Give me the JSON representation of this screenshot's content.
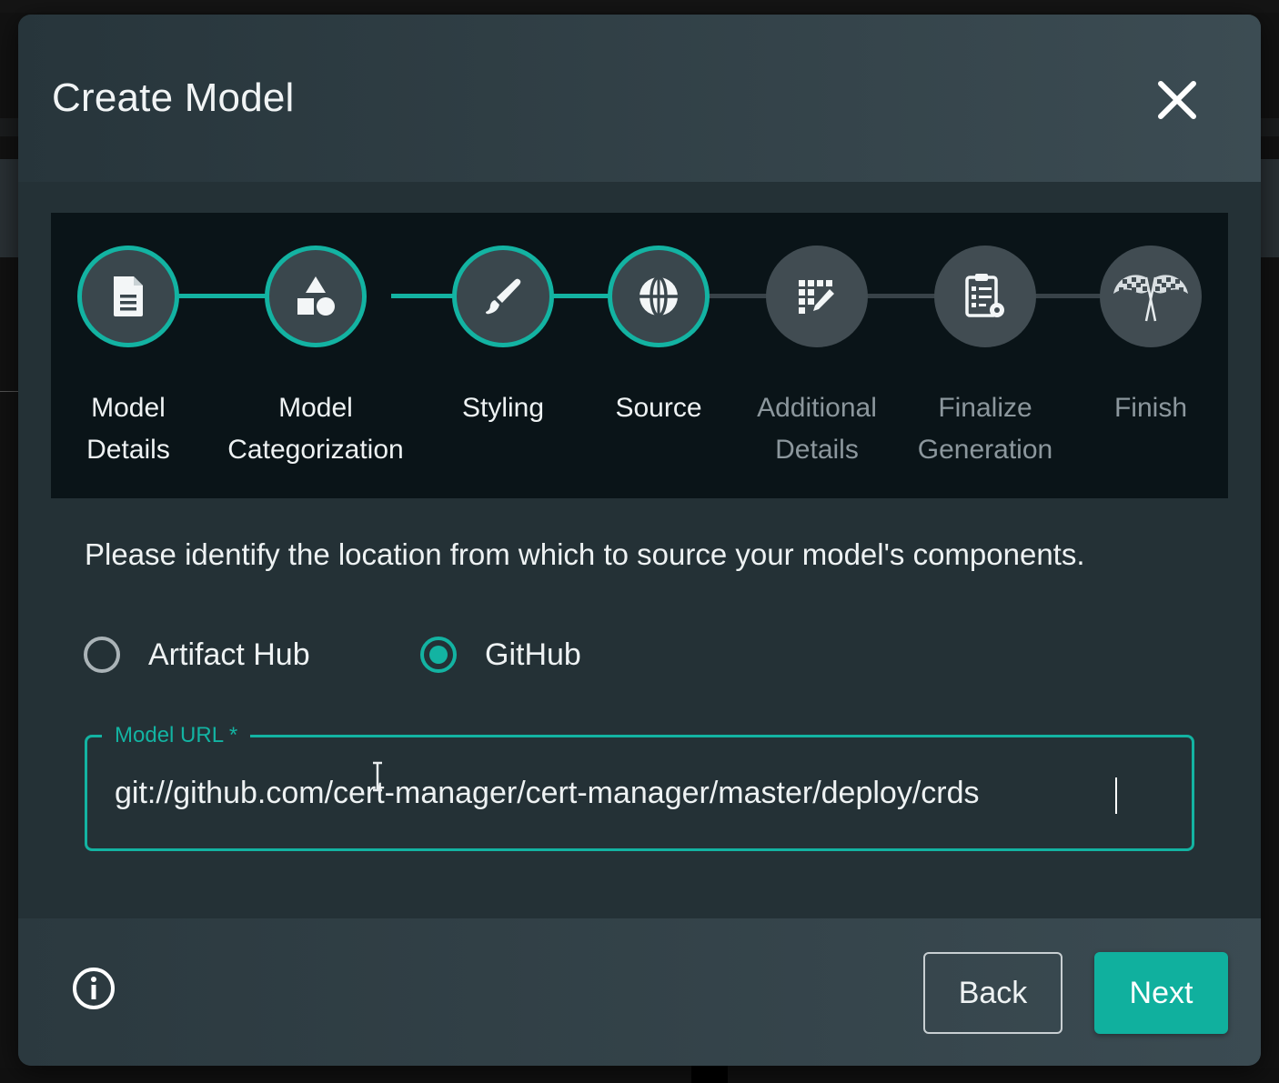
{
  "dialog": {
    "title": "Create Model"
  },
  "stepper": {
    "steps": [
      {
        "label": "Model\nDetails",
        "icon": "document-icon",
        "status": "completed"
      },
      {
        "label": "Model\nCategorization",
        "icon": "shapes-icon",
        "status": "completed"
      },
      {
        "label": "Styling",
        "icon": "paintbrush-icon",
        "status": "completed"
      },
      {
        "label": "Source",
        "icon": "globe-icon",
        "status": "active"
      },
      {
        "label": "Additional\nDetails",
        "icon": "grid-edit-icon",
        "status": "pending"
      },
      {
        "label": "Finalize\nGeneration",
        "icon": "clipboard-gear-icon",
        "status": "pending"
      },
      {
        "label": "Finish",
        "icon": "checkered-flags-icon",
        "status": "pending"
      }
    ]
  },
  "source": {
    "instructions": "Please identify the location from which to source your model's components.",
    "options": [
      {
        "label": "Artifact Hub",
        "selected": false
      },
      {
        "label": "GitHub",
        "selected": true
      }
    ],
    "url_field": {
      "label": "Model URL *",
      "value": "git://github.com/cert-manager/cert-manager/master/deploy/crds"
    }
  },
  "footer": {
    "back_label": "Back",
    "next_label": "Next"
  },
  "colors": {
    "accent": "#13b3a2",
    "dialog_background": "#243136",
    "stepper_background": "#0a1418"
  }
}
